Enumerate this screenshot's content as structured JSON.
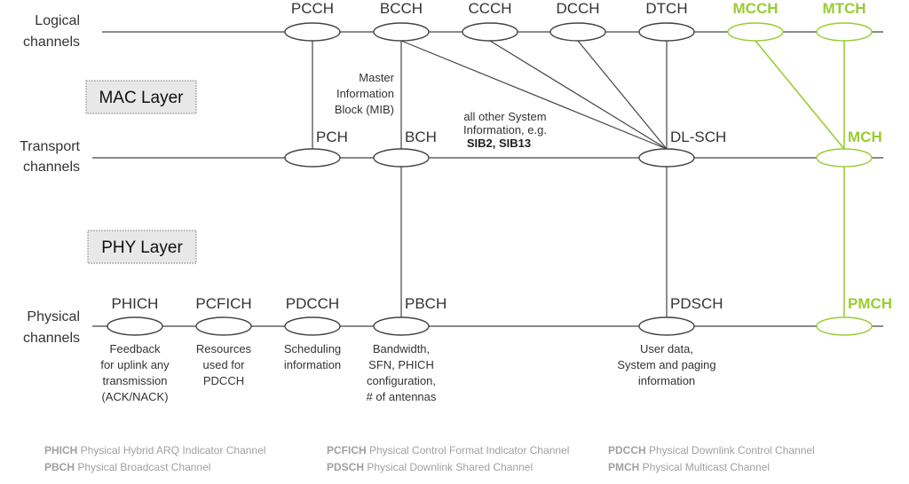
{
  "colors": {
    "line": "#444444",
    "text": "#333333",
    "mbms": "#99cc33",
    "legend": "#a0a0a0",
    "layer_box": "#e8e8e8"
  },
  "rows": [
    {
      "id": "logical",
      "label": [
        "Logical",
        "channels"
      ]
    },
    {
      "id": "transport",
      "label": [
        "Transport",
        "channels"
      ]
    },
    {
      "id": "physical",
      "label": [
        "Physical",
        "channels"
      ]
    }
  ],
  "layers": [
    {
      "id": "mac",
      "label": "MAC Layer"
    },
    {
      "id": "phy",
      "label": "PHY Layer"
    }
  ],
  "channels": {
    "logical": [
      {
        "id": "PCCH",
        "name": "PCCH",
        "mbms": false
      },
      {
        "id": "BCCH",
        "name": "BCCH",
        "mbms": false
      },
      {
        "id": "CCCH",
        "name": "CCCH",
        "mbms": false
      },
      {
        "id": "DCCH",
        "name": "DCCH",
        "mbms": false
      },
      {
        "id": "DTCH",
        "name": "DTCH",
        "mbms": false
      },
      {
        "id": "MCCH",
        "name": "MCCH",
        "mbms": true
      },
      {
        "id": "MTCH",
        "name": "MTCH",
        "mbms": true
      }
    ],
    "transport": [
      {
        "id": "PCH",
        "name": "PCH",
        "mbms": false
      },
      {
        "id": "BCH",
        "name": "BCH",
        "mbms": false
      },
      {
        "id": "DLSCH",
        "name": "DL-SCH",
        "mbms": false
      },
      {
        "id": "MCH",
        "name": "MCH",
        "mbms": true
      }
    ],
    "physical": [
      {
        "id": "PHICH",
        "name": "PHICH",
        "mbms": false,
        "desc": [
          "Feedback",
          "for uplink any",
          "transmission",
          "(ACK/NACK)"
        ]
      },
      {
        "id": "PCFICH",
        "name": "PCFICH",
        "mbms": false,
        "desc": [
          "Resources",
          "used for",
          "PDCCH"
        ]
      },
      {
        "id": "PDCCH",
        "name": "PDCCH",
        "mbms": false,
        "desc": [
          "Scheduling",
          "information"
        ]
      },
      {
        "id": "PBCH",
        "name": "PBCH",
        "mbms": false,
        "desc": [
          "Bandwidth,",
          "SFN, PHICH",
          "configuration,",
          "# of antennas"
        ]
      },
      {
        "id": "PDSCH",
        "name": "PDSCH",
        "mbms": false,
        "desc": [
          "User data,",
          "System and paging",
          "information"
        ]
      },
      {
        "id": "PMCH",
        "name": "PMCH",
        "mbms": true
      }
    ]
  },
  "mappings": [
    {
      "from": "PCCH",
      "to": "PCH"
    },
    {
      "from": "BCCH",
      "to": "BCH",
      "note": [
        "Master",
        "Information",
        "Block (MIB)"
      ]
    },
    {
      "from": "BCCH",
      "to": "DLSCH",
      "note": [
        "all other System",
        "Information, e.g."
      ],
      "note_bold": "SIB2, SIB13"
    },
    {
      "from": "CCCH",
      "to": "DLSCH"
    },
    {
      "from": "DCCH",
      "to": "DLSCH"
    },
    {
      "from": "DTCH",
      "to": "DLSCH"
    },
    {
      "from": "MCCH",
      "to": "MCH"
    },
    {
      "from": "MTCH",
      "to": "MCH"
    },
    {
      "from": "BCH",
      "to": "PBCH"
    },
    {
      "from": "DLSCH",
      "to": "PDSCH"
    },
    {
      "from": "MCH",
      "to": "PMCH"
    }
  ],
  "legend": [
    {
      "abbr": "PHICH",
      "full": "Physical Hybrid ARQ Indicator Channel"
    },
    {
      "abbr": "PCFICH",
      "full": "Physical Control Format Indicator Channel"
    },
    {
      "abbr": "PDCCH",
      "full": "Physical Downlink Control Channel"
    },
    {
      "abbr": "PBCH",
      "full": "Physical Broadcast Channel"
    },
    {
      "abbr": "PDSCH",
      "full": "Physical Downlink Shared Channel"
    },
    {
      "abbr": "PMCH",
      "full": "Physical Multicast Channel"
    }
  ]
}
